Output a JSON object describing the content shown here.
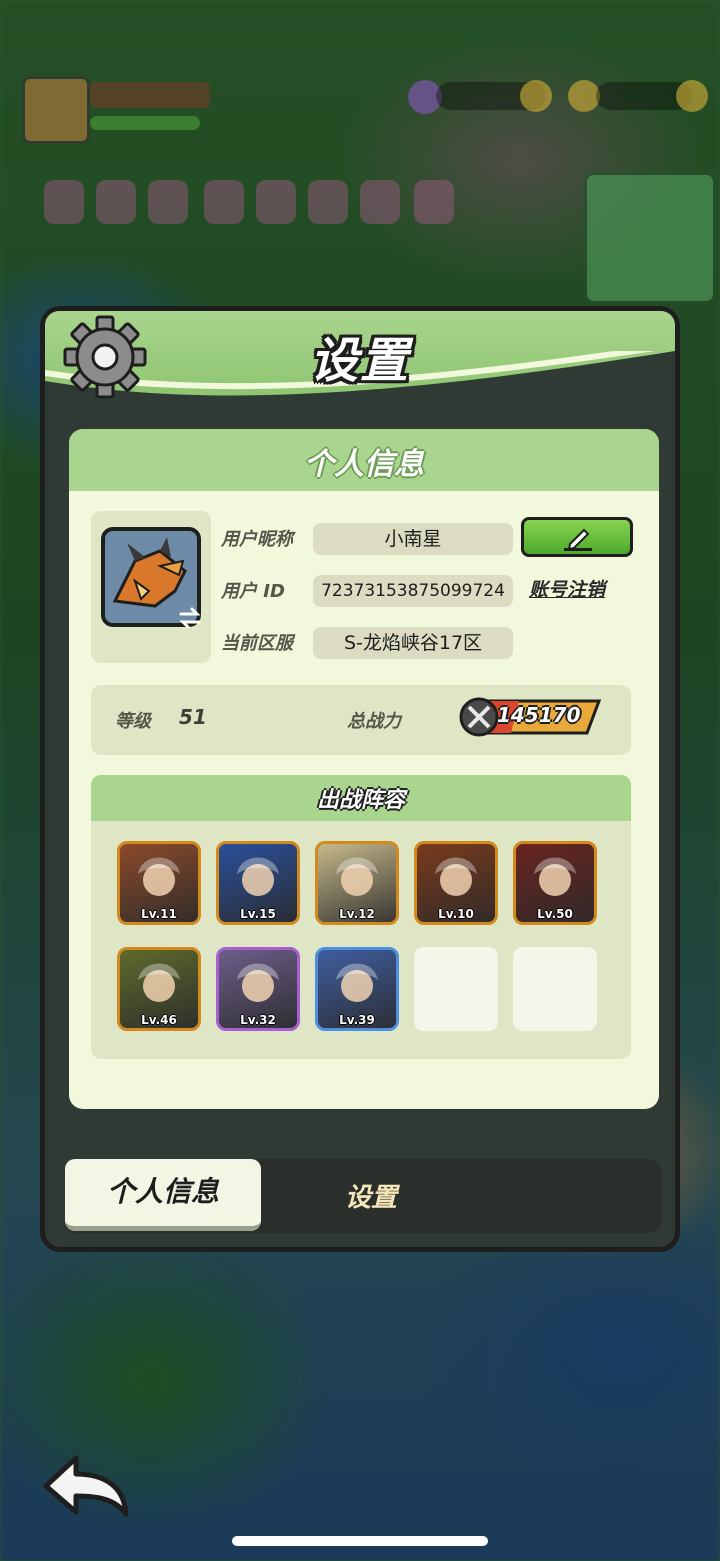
{
  "dialog": {
    "title": "设置",
    "gear_icon": "gear-icon"
  },
  "profile": {
    "section_title": "个人信息",
    "nickname_label": "用户昵称",
    "nickname_value": "小南星",
    "id_label": "用户 ID",
    "id_value": "7237315387509972​4",
    "server_label": "当前区服",
    "server_value": "S-龙焰峡谷17区",
    "cancel_account": "账号注销",
    "edit_icon": "pencil-icon",
    "swap_icon": "swap-icon"
  },
  "stats": {
    "level_label": "等级",
    "level_value": "51",
    "power_label": "总战力",
    "power_value": "145170"
  },
  "lineup": {
    "title": "出战阵容",
    "heroes": [
      {
        "level": "Lv.11",
        "rarity": "gold",
        "color": "#8b4a2a"
      },
      {
        "level": "Lv.15",
        "rarity": "gold",
        "color": "#2a4f9a"
      },
      {
        "level": "Lv.12",
        "rarity": "gold",
        "color": "#c7b98a"
      },
      {
        "level": "Lv.10",
        "rarity": "gold",
        "color": "#7a3a1c"
      },
      {
        "level": "Lv.50",
        "rarity": "gold",
        "color": "#6a2420"
      },
      {
        "level": "Lv.46",
        "rarity": "gold",
        "color": "#5e6a2c"
      },
      {
        "level": "Lv.32",
        "rarity": "purple",
        "color": "#6c5e8a"
      },
      {
        "level": "Lv.39",
        "rarity": "blue",
        "color": "#3f5ea0"
      }
    ],
    "empty_slots": 2
  },
  "tabs": {
    "active": "个人信息",
    "inactive": "设置"
  },
  "colors": {
    "header_green": "#a9d58e",
    "panel_cream": "#f2f8dc",
    "edit_green": "#4fa82e"
  }
}
